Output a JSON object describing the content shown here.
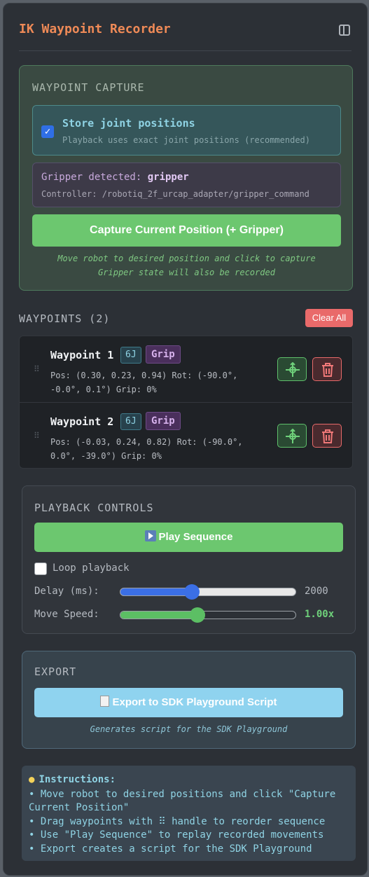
{
  "header": {
    "title": "IK Waypoint Recorder"
  },
  "capture": {
    "section_label": "WAYPOINT CAPTURE",
    "store_title": "Store joint positions",
    "store_sub": "Playback uses exact joint positions (recommended)",
    "store_checked": true,
    "gripper_prefix": "Gripper detected: ",
    "gripper_name": "gripper",
    "controller": "Controller: /robotiq_2f_urcap_adapter/gripper_command",
    "button": "Capture Current Position (+ Gripper)",
    "hint1": "Move robot to desired position and click to capture",
    "hint2": "Gripper state will also be recorded"
  },
  "waypoints": {
    "section_label": "WAYPOINTS (2)",
    "clear_label": "Clear All",
    "items": [
      {
        "name": "Waypoint 1",
        "badge_joints": "6J",
        "badge_grip": "Grip",
        "detail": "Pos: (0.30, 0.23, 0.94) Rot: (-90.0°, -0.0°, 0.1°) Grip: 0%"
      },
      {
        "name": "Waypoint 2",
        "badge_joints": "6J",
        "badge_grip": "Grip",
        "detail": "Pos: (-0.03, 0.24, 0.82) Rot: (-90.0°, 0.0°, -39.0°) Grip: 0%"
      }
    ]
  },
  "playback": {
    "section_label": "PLAYBACK CONTROLS",
    "play_label": "Play Sequence",
    "loop_label": "Loop playback",
    "loop_checked": false,
    "delay_label": "Delay (ms):",
    "delay_value": "2000",
    "delay_fraction": 0.41,
    "speed_label": "Move Speed:",
    "speed_value": "1.00x",
    "speed_fraction": 0.44,
    "delay_color": "#3b6fe6",
    "speed_color": "#5cbf64"
  },
  "export": {
    "section_label": "EXPORT",
    "button": "Export to SDK Playground Script",
    "hint": "Generates script for the SDK Playground"
  },
  "instructions": {
    "title": "Instructions:",
    "lines": [
      "• Move robot to desired positions and click \"Capture Current Position\"",
      "• Drag waypoints with ⠿ handle to reorder sequence",
      "• Use \"Play Sequence\" to replay recorded movements",
      "• Export creates a script for the SDK Playground"
    ]
  }
}
